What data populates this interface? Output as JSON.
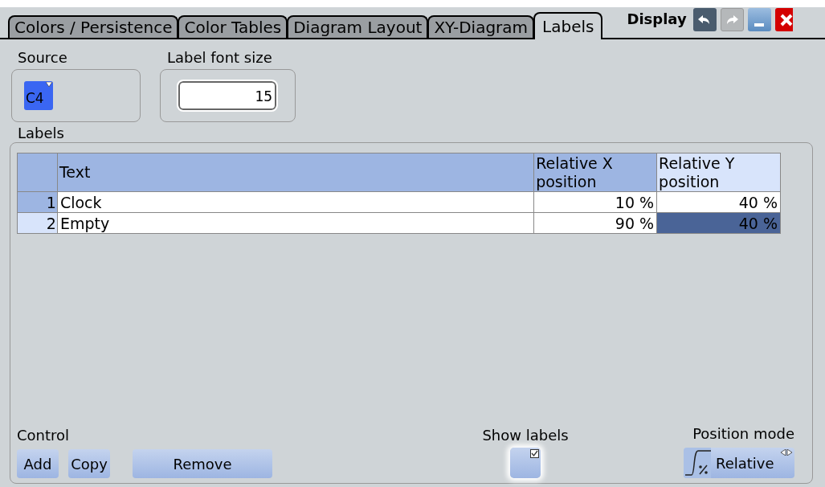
{
  "tabs": [
    {
      "label": "Colors / Persistence",
      "selected": false
    },
    {
      "label": "Color Tables",
      "selected": false
    },
    {
      "label": "Diagram Layout",
      "selected": false
    },
    {
      "label": "XY-Diagram",
      "selected": false
    },
    {
      "label": "Labels",
      "selected": true
    }
  ],
  "window": {
    "title": "Display"
  },
  "source": {
    "label": "Source",
    "value": "C4"
  },
  "label_font_size": {
    "label": "Label font size",
    "value": "15"
  },
  "labels": {
    "title": "Labels",
    "columns": [
      {
        "label": "Text",
        "selected": false
      },
      {
        "label": "Relative X position",
        "selected": false
      },
      {
        "label": "Relative Y position",
        "selected": true
      }
    ],
    "rows": [
      {
        "number": "1",
        "selected": false,
        "cells": [
          {
            "text": "Clock",
            "selected": false
          },
          {
            "text": "10 %",
            "selected": false
          },
          {
            "text": "40 %",
            "selected": false
          }
        ]
      },
      {
        "number": "2",
        "selected": true,
        "cells": [
          {
            "text": "Empty",
            "selected": false
          },
          {
            "text": "90 %",
            "selected": false
          },
          {
            "text": "40 %",
            "selected": true
          }
        ]
      }
    ]
  },
  "control": {
    "label": "Control",
    "buttons": [
      "Add",
      "Copy",
      "Remove"
    ]
  },
  "show_labels": {
    "label": "Show labels",
    "checked": true
  },
  "position_mode": {
    "label": "Position mode",
    "value": "Relative"
  }
}
